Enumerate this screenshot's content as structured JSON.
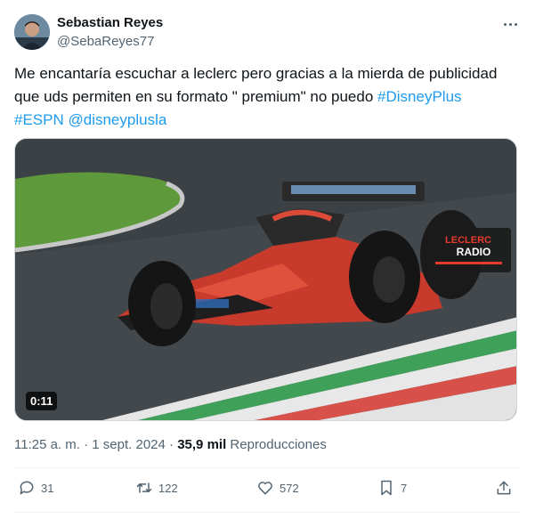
{
  "author": {
    "name": "Sebastian Reyes",
    "handle": "@SebaReyes77"
  },
  "tweet": {
    "text_plain": "Me encantaría escuchar a leclerc pero gracias a la mierda de publicidad que uds permiten en su formato \" premium\" no puedo ",
    "hashtag1": "#DisneyPlus",
    "hashtag2": "#ESPN",
    "mention": "@disneyplusla"
  },
  "media": {
    "duration": "0:11",
    "overlay_line1": "LECLERC",
    "overlay_line2": "RADIO"
  },
  "meta": {
    "time": "11:25 a. m.",
    "separator": "·",
    "date": "1 sept. 2024",
    "views_count": "35,9 mil",
    "views_label": "Reproducciones"
  },
  "actions": {
    "replies": "31",
    "reposts": "122",
    "likes": "572",
    "bookmarks": "7"
  },
  "colors": {
    "link": "#1d9bf0",
    "muted": "#536471"
  }
}
